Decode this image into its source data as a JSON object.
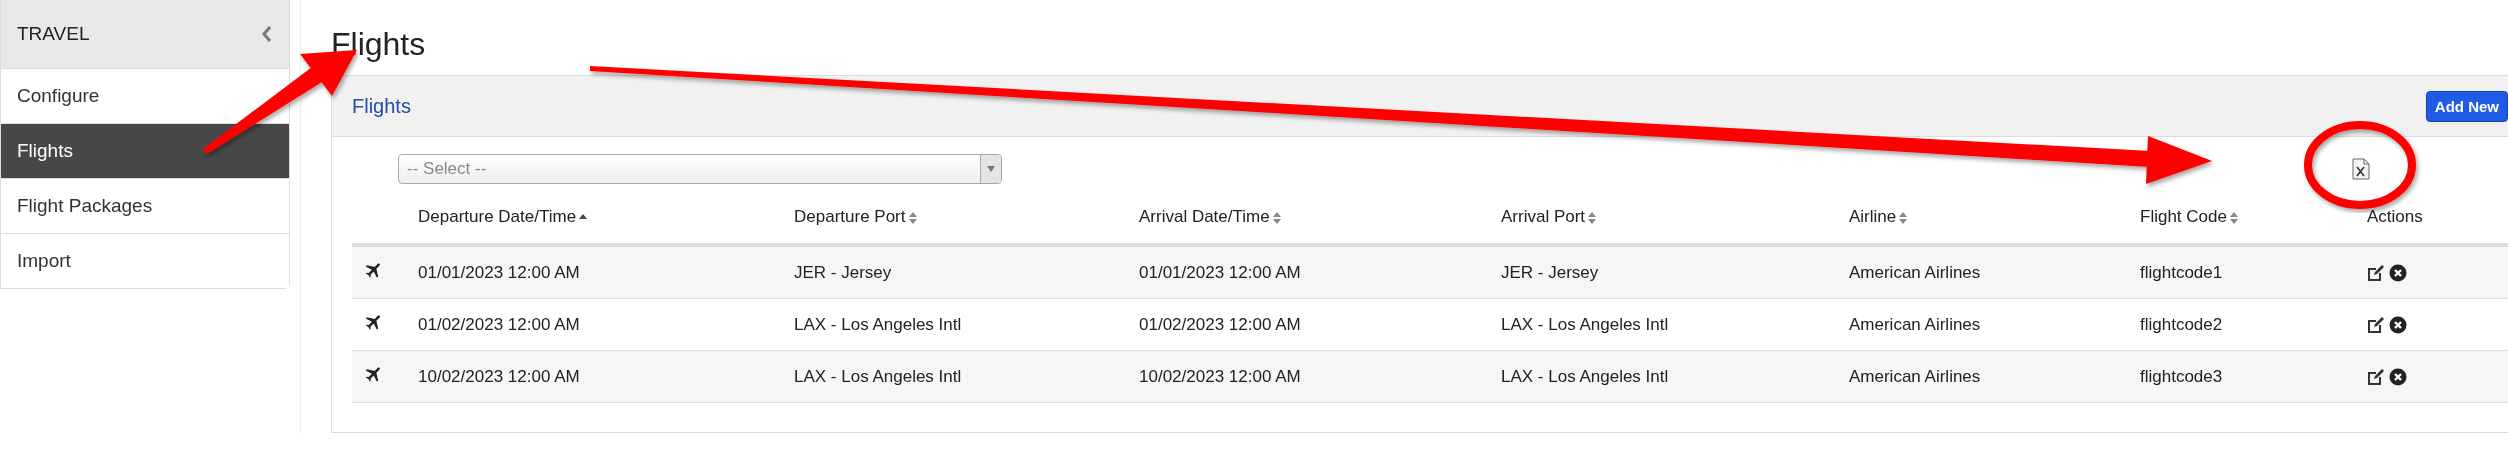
{
  "sidebar": {
    "title": "TRAVEL",
    "items": [
      {
        "label": "Configure",
        "selected": false
      },
      {
        "label": "Flights",
        "selected": true
      },
      {
        "label": "Flight Packages",
        "selected": false
      },
      {
        "label": "Import",
        "selected": false
      }
    ]
  },
  "page_title": "Flights",
  "panel": {
    "title": "Flights",
    "add_button": "Add New",
    "filter": {
      "placeholder": "-- Select --"
    },
    "table": {
      "columns": [
        {
          "label": "Departure Date/Time",
          "sortable": true,
          "sorted_ascending": true
        },
        {
          "label": "Departure Port",
          "sortable": true,
          "sorted_ascending": false
        },
        {
          "label": "Arrival Date/Time",
          "sortable": true,
          "sorted_ascending": false
        },
        {
          "label": "Arrival Port",
          "sortable": true,
          "sorted_ascending": false
        },
        {
          "label": "Airline",
          "sortable": true,
          "sorted_ascending": false
        },
        {
          "label": "Flight Code",
          "sortable": true,
          "sorted_ascending": false
        },
        {
          "label": "Actions",
          "sortable": false
        }
      ],
      "rows": [
        {
          "cells": [
            "01/01/2023 12:00 AM",
            "JER - Jersey",
            "01/01/2023 12:00 AM",
            "JER - Jersey",
            "American Airlines",
            "flightcode1"
          ]
        },
        {
          "cells": [
            "01/02/2023 12:00 AM",
            "LAX - Los Angeles Intl",
            "01/02/2023 12:00 AM",
            "LAX - Los Angeles Intl",
            "American Airlines",
            "flightcode2"
          ]
        },
        {
          "cells": [
            "10/02/2023 12:00 AM",
            "LAX - Los Angeles Intl",
            "10/02/2023 12:00 AM",
            "LAX - Los Angeles Intl",
            "American Airlines",
            "flightcode3"
          ]
        }
      ]
    }
  }
}
